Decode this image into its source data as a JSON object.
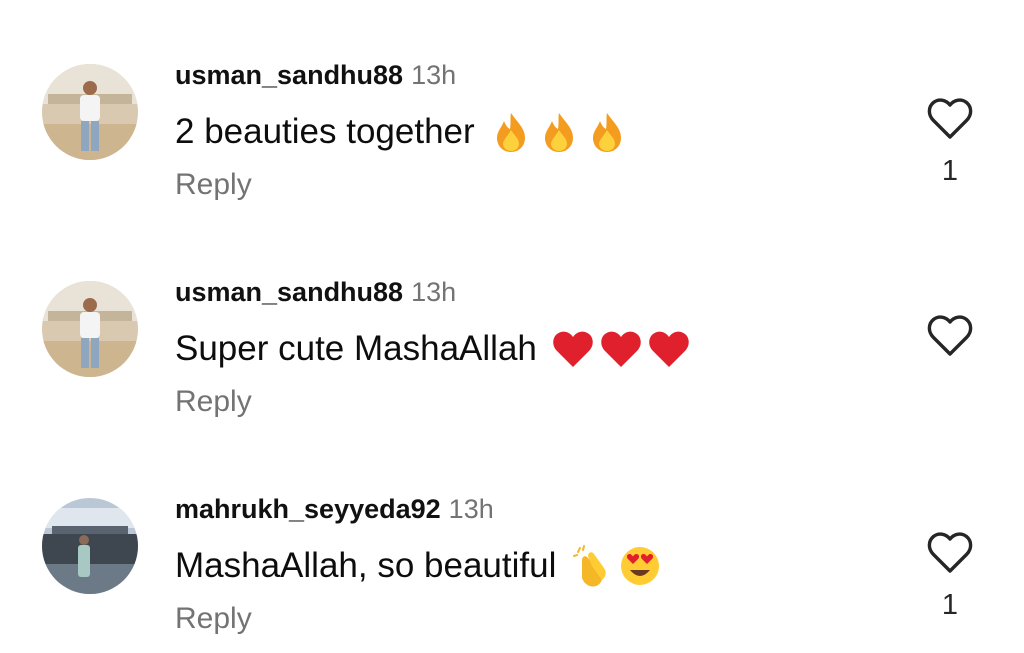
{
  "comments": [
    {
      "username": "usman_sandhu88",
      "time": "13h",
      "text": "2 beauties together",
      "emojis": [
        "fire-icon",
        "fire-icon",
        "fire-icon"
      ],
      "reply_label": "Reply",
      "likes": "1",
      "like_icon": "heart-outline-icon"
    },
    {
      "username": "usman_sandhu88",
      "time": "13h",
      "text": "Super cute MashaAllah",
      "emojis": [
        "red-heart-icon",
        "red-heart-icon",
        "red-heart-icon"
      ],
      "reply_label": "Reply",
      "likes": "",
      "like_icon": "heart-outline-icon"
    },
    {
      "username": "mahrukh_seyyeda92",
      "time": "13h",
      "text": "MashaAllah, so beautiful",
      "emojis": [
        "clapping-hands-icon",
        "heart-eyes-icon"
      ],
      "reply_label": "Reply",
      "likes": "1",
      "like_icon": "heart-outline-icon"
    }
  ],
  "colors": {
    "username": "#111111",
    "secondary_text": "#737373",
    "fire": "#f5a623",
    "heart_red": "#e0202c",
    "heart_outline": "#262626"
  }
}
